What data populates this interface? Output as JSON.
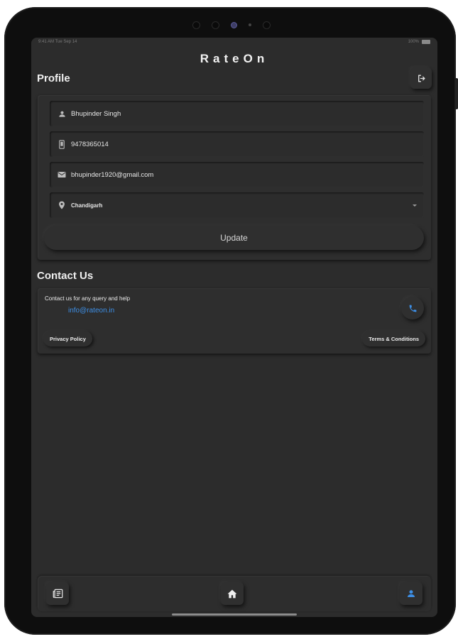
{
  "status_bar": {
    "left": "9:41 AM Tue Sep 14",
    "right": "100%"
  },
  "app": {
    "title": "RateOn"
  },
  "profile": {
    "section_title": "Profile",
    "fields": {
      "name": "Bhupinder Singh",
      "phone": "9478365014",
      "email": "bhupinder1920@gmail.com",
      "city": "Chandigarh"
    },
    "update_label": "Update"
  },
  "contact": {
    "section_title": "Contact Us",
    "text": "Contact us for any query and help",
    "email": "info@rateon.in",
    "privacy_label": "Privacy Policy",
    "terms_label": "Terms & Conditions"
  },
  "colors": {
    "background": "#2c2c2c",
    "accent": "#3d8fe6",
    "text": "#e8e8e8"
  },
  "icons": [
    "logout-icon",
    "person-icon",
    "smartphone-icon",
    "mail-icon",
    "location-pin-icon",
    "chevron-down-icon",
    "phone-icon",
    "newspaper-icon",
    "home-icon",
    "profile-icon"
  ]
}
